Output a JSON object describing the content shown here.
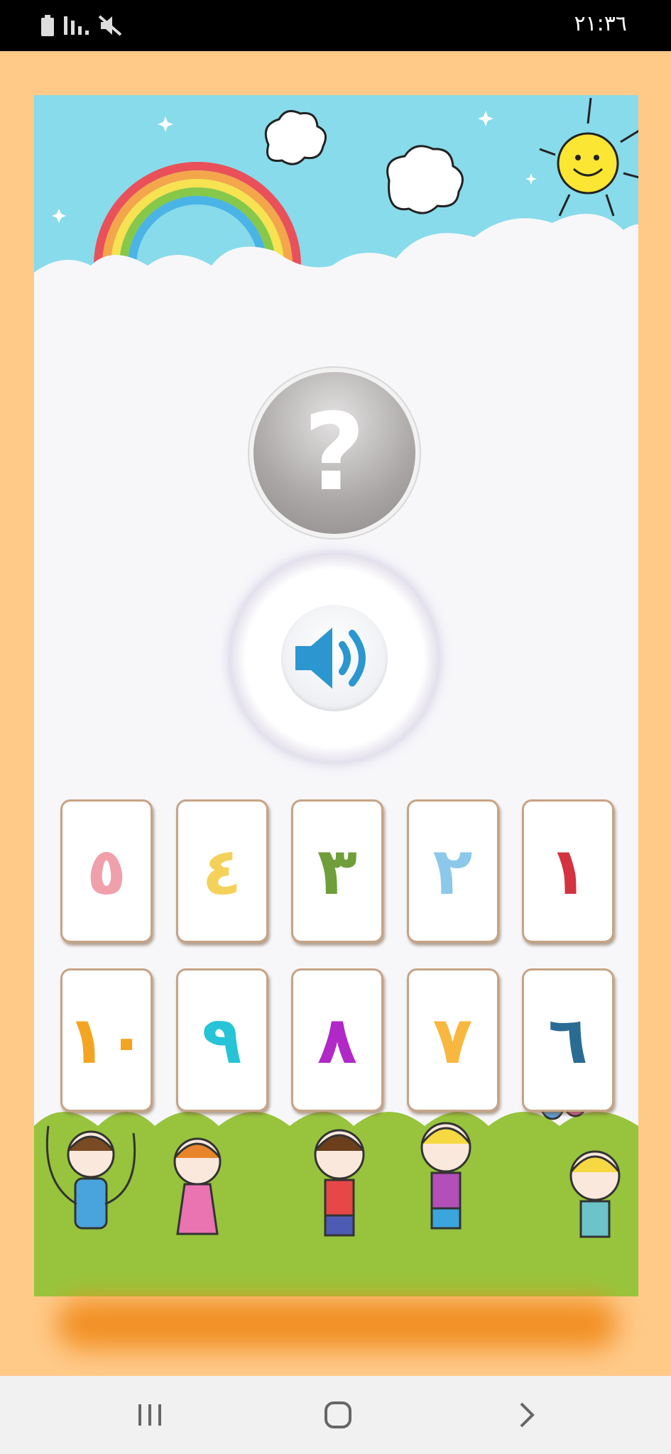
{
  "status_bar": {
    "time": "٢١:٣٦",
    "icons": [
      "battery-icon",
      "signal-icon",
      "mute-icon"
    ]
  },
  "question_button": {
    "label": "?",
    "icon": "question-icon"
  },
  "sound_button": {
    "icon": "speaker-icon"
  },
  "cards": {
    "row1": [
      {
        "digit": "٥",
        "color": "#f0a0ab"
      },
      {
        "digit": "٤",
        "color": "#f4d25a"
      },
      {
        "digit": "٣",
        "color": "#6f9e3a"
      },
      {
        "digit": "٢",
        "color": "#8cc8ea"
      },
      {
        "digit": "١",
        "color": "#d3323f"
      }
    ],
    "row2": [
      {
        "digit": "١٠",
        "color": "#f3a421"
      },
      {
        "digit": "٩",
        "color": "#27c3d6"
      },
      {
        "digit": "٨",
        "color": "#b028c6"
      },
      {
        "digit": "٧",
        "color": "#f8b73f"
      },
      {
        "digit": "٦",
        "color": "#2a6b94"
      }
    ]
  },
  "nav_bar": {
    "items": [
      "recents-icon",
      "home-icon",
      "back-icon"
    ]
  }
}
